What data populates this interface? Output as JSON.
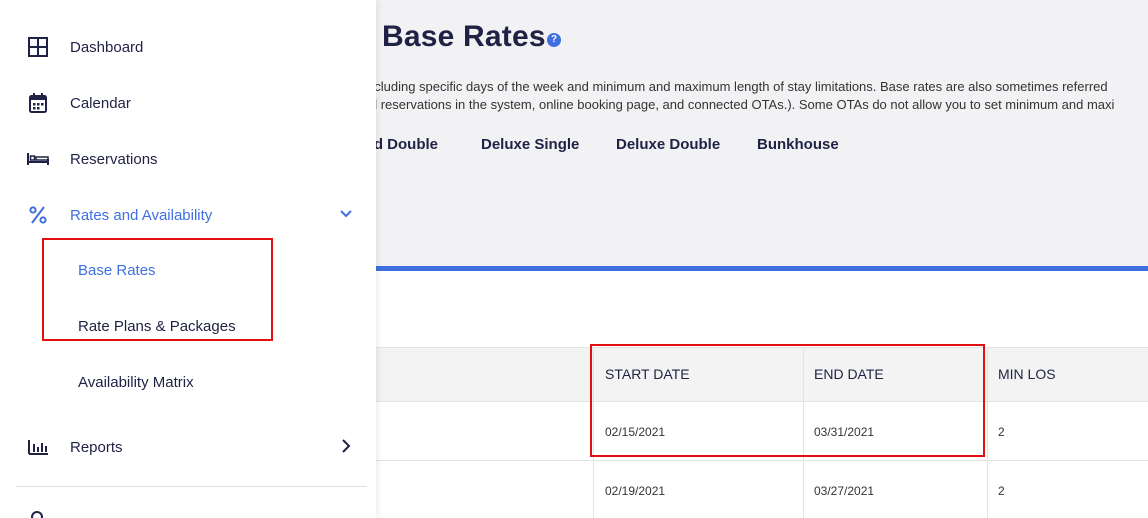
{
  "sidebar": {
    "items": [
      {
        "label": "Dashboard",
        "icon": "grid-icon"
      },
      {
        "label": "Calendar",
        "icon": "calendar-icon"
      },
      {
        "label": "Reservations",
        "icon": "bed-icon"
      },
      {
        "label": "Rates and Availability",
        "icon": "percent-icon",
        "expanded": true
      },
      {
        "label": "Reports",
        "icon": "bar-chart-icon"
      }
    ],
    "subitems": [
      {
        "label": "Base Rates",
        "active": true
      },
      {
        "label": "Rate Plans & Packages"
      },
      {
        "label": "Availability Matrix"
      }
    ]
  },
  "page": {
    "title": "Base Rates",
    "description_line1": "ncluding specific days of the week and minimum and maximum length of stay limitations. Base rates are also sometimes referred",
    "description_line2": "al reservations in the system, online booking page, and connected OTAs.). Some OTAs do not allow you to set minimum and maxi",
    "tabs": [
      "rd Double",
      "Deluxe Single",
      "Deluxe Double",
      "Bunkhouse"
    ]
  },
  "table": {
    "columns": [
      "START DATE",
      "END DATE",
      "MIN LOS"
    ],
    "rows": [
      {
        "start": "02/15/2021",
        "end": "03/31/2021",
        "min_los": "2"
      },
      {
        "start": "02/19/2021",
        "end": "03/27/2021",
        "min_los": "2"
      }
    ]
  },
  "colors": {
    "accent": "#3f6fe0",
    "highlight": "#e01010",
    "text": "#1f2244"
  }
}
